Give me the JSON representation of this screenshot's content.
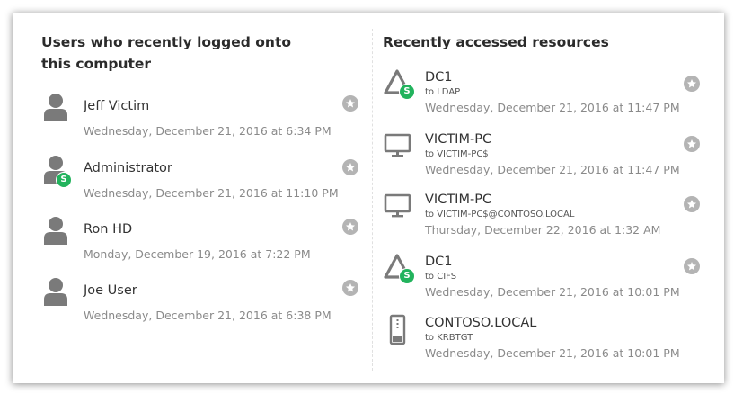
{
  "users_panel": {
    "title": "Users who recently logged onto this computer",
    "items": [
      {
        "name": "Jeff Victim",
        "time": "Wednesday, December 21, 2016 at 6:34 PM",
        "sensitive": false
      },
      {
        "name": "Administrator",
        "time": "Wednesday, December 21, 2016 at 11:10 PM",
        "sensitive": true,
        "badge": "S"
      },
      {
        "name": "Ron HD",
        "time": "Monday, December 19, 2016 at 7:22 PM",
        "sensitive": false
      },
      {
        "name": "Joe User",
        "time": "Wednesday, December 21, 2016 at 6:38 PM",
        "sensitive": false
      }
    ]
  },
  "resources_panel": {
    "title": "Recently accessed resources",
    "items": [
      {
        "name": "DC1",
        "target": "to LDAP",
        "time": "Wednesday, December 21, 2016 at 11:47 PM",
        "icon": "domain-controller-icon",
        "badge": "S"
      },
      {
        "name": "VICTIM-PC",
        "target": "to VICTIM-PC$",
        "time": "Wednesday, December 21, 2016 at 11:47 PM",
        "icon": "monitor-icon"
      },
      {
        "name": "VICTIM-PC",
        "target": "to VICTIM-PC$@CONTOSO.LOCAL",
        "time": "Thursday, December 22, 2016 at 1:32 AM",
        "icon": "monitor-icon"
      },
      {
        "name": "DC1",
        "target": "to CIFS",
        "time": "Wednesday, December 21, 2016 at 10:01 PM",
        "icon": "domain-controller-icon",
        "badge": "S"
      },
      {
        "name": "CONTOSO.LOCAL",
        "target": "to KRBTGT",
        "time": "Wednesday, December 21, 2016 at 10:01 PM",
        "icon": "server-tower-icon"
      }
    ]
  },
  "colors": {
    "sensitive_badge": "#22b35d",
    "favorite_button": "#b4b4b4",
    "icon_gray": "#7a7a7a",
    "timestamp": "#8a8a8a"
  }
}
